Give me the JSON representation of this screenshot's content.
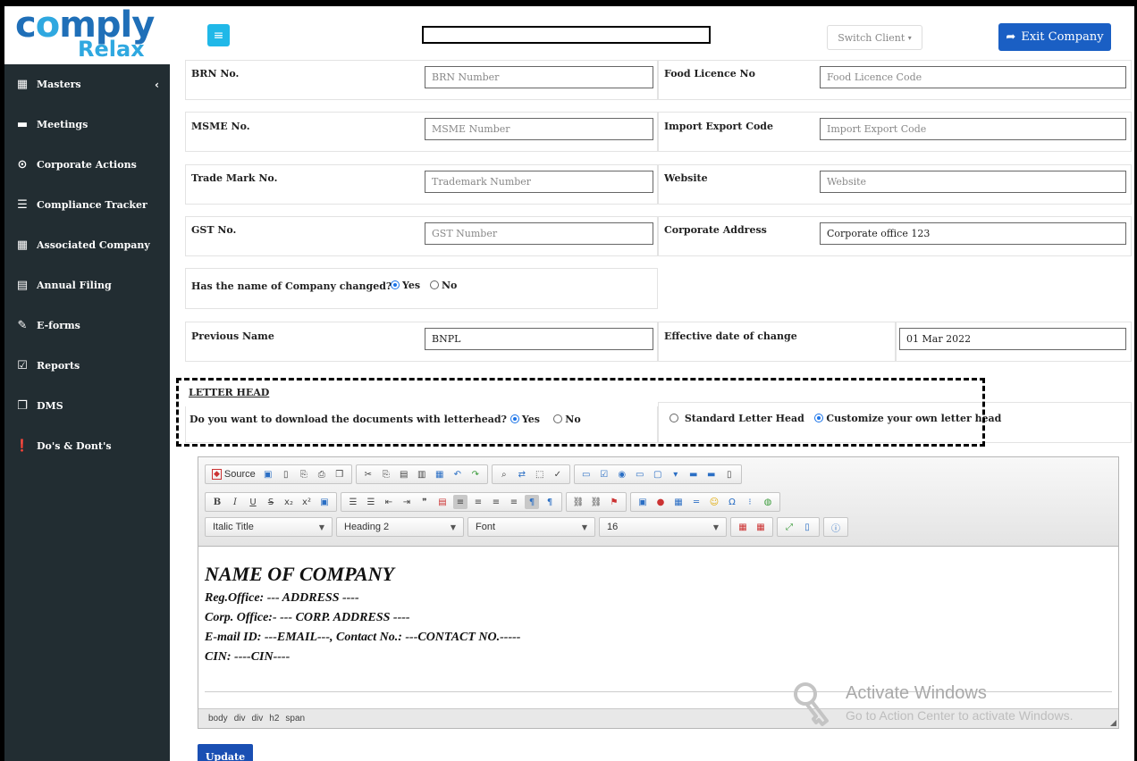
{
  "logo": {
    "line1_pre": "c",
    "line1_o": "o",
    "line1_post": "mply",
    "line2": "Relax"
  },
  "sidebar": {
    "items": [
      {
        "label": "Masters",
        "icon": "building-icon",
        "glyph": "▦",
        "has_chevron": true
      },
      {
        "label": "Meetings",
        "icon": "briefcase-icon",
        "glyph": "▬"
      },
      {
        "label": "Corporate Actions",
        "icon": "dot-circle-icon",
        "glyph": "⊙"
      },
      {
        "label": "Compliance Tracker",
        "icon": "list-icon",
        "glyph": "☰"
      },
      {
        "label": "Associated Company",
        "icon": "building-icon",
        "glyph": "▦"
      },
      {
        "label": "Annual Filing",
        "icon": "file-icon",
        "glyph": "▤"
      },
      {
        "label": "E-forms",
        "icon": "edit-icon",
        "glyph": "✎"
      },
      {
        "label": "Reports",
        "icon": "check-square-icon",
        "glyph": "☑"
      },
      {
        "label": "DMS",
        "icon": "copy-icon",
        "glyph": "❐"
      },
      {
        "label": "Do's & Dont's",
        "icon": "exclamation-circle-icon",
        "glyph": "❗"
      }
    ],
    "chevron": "‹"
  },
  "header": {
    "menu_glyph": "≡",
    "switch_client": "Switch Client",
    "switch_caret": "▾",
    "exit_label": "Exit Company",
    "exit_glyph": "➦"
  },
  "form": {
    "brn_label": "BRN No.",
    "brn_placeholder": "BRN Number",
    "food_label": "Food Licence No",
    "food_placeholder": "Food Licence Code",
    "msme_label": "MSME No.",
    "msme_placeholder": "MSME Number",
    "iec_label": "Import Export Code",
    "iec_placeholder": "Import Export Code",
    "tm_label": "Trade Mark No.",
    "tm_placeholder": "Trademark Number",
    "website_label": "Website",
    "website_placeholder": "Website",
    "gst_label": "GST No.",
    "gst_placeholder": "GST Number",
    "corp_addr_label": "Corporate Address",
    "corp_addr_value": "Corporate office 123",
    "name_changed_label": "Has the name of Company changed?",
    "yes": "Yes",
    "no": "No",
    "name_changed_selected": "Yes",
    "prev_name_label": "Previous Name",
    "prev_name_value": "BNPL",
    "eff_date_label": "Effective date of change",
    "eff_date_value": "01 Mar 2022"
  },
  "letterhead": {
    "section_title": "LETTER HEAD",
    "question": "Do you want to download the documents with letterhead?",
    "download_selected": "Yes",
    "standard": "Standard Letter Head",
    "customize": "Customize your own letter head",
    "type_selected": "Customize your own letter head"
  },
  "editor": {
    "source_label": "Source",
    "combo_style": "Italic Title",
    "combo_format": "Heading 2",
    "combo_font": "Font",
    "combo_size": "16",
    "content": {
      "heading": "NAME OF COMPANY",
      "line1": "Reg.Office: --- ADDRESS ----",
      "line2": "Corp. Office:- --- CORP. ADDRESS ----",
      "line3": "E-mail ID:  ---EMAIL---, Contact No.: ---CONTACT NO.-----",
      "line4": "CIN: ----CIN----"
    },
    "path": [
      "body",
      "div",
      "div",
      "h2",
      "span"
    ]
  },
  "watermark": {
    "title": "Activate Windows",
    "subtitle": "Go to Action Center to activate Windows."
  },
  "update_label": "Update"
}
